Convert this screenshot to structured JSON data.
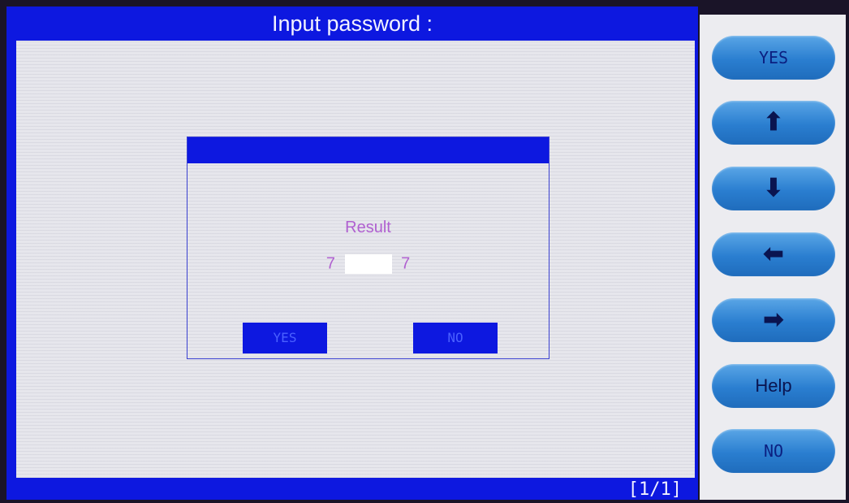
{
  "header": {
    "title": "Input password :"
  },
  "dialog": {
    "label": "Result",
    "left_digit": "7",
    "right_digit": "7",
    "yes_label": "YES",
    "no_label": "NO"
  },
  "status": {
    "page": "[1/1]"
  },
  "sidebar": {
    "yes": "YES",
    "up": "⬆",
    "down": "⬇",
    "left": "⬅",
    "right": "➡",
    "help": "Help",
    "no": "NO"
  }
}
